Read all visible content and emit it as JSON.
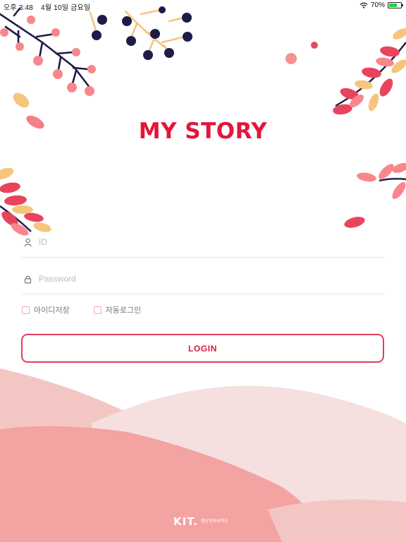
{
  "status_bar": {
    "time": "오후 3:48",
    "date": "4월 10일 금요일",
    "battery": "70%",
    "battery_level": 0.7
  },
  "app": {
    "title": "MY STORY"
  },
  "login_form": {
    "id_placeholder": "ID",
    "password_placeholder": "Password",
    "save_id_label": "아이디저장",
    "auto_login_label": "자동로그인",
    "login_button_label": "LOGIN"
  },
  "footer": {
    "logo_mark": "KIT.",
    "school_name": "경남정보대학교"
  },
  "colors": {
    "accent": "#e3163a",
    "button_border": "#e0405a",
    "hill_light": "#f5e0df",
    "hill_mid": "#f4c6c3",
    "hill_dark": "#f3a3a2"
  }
}
